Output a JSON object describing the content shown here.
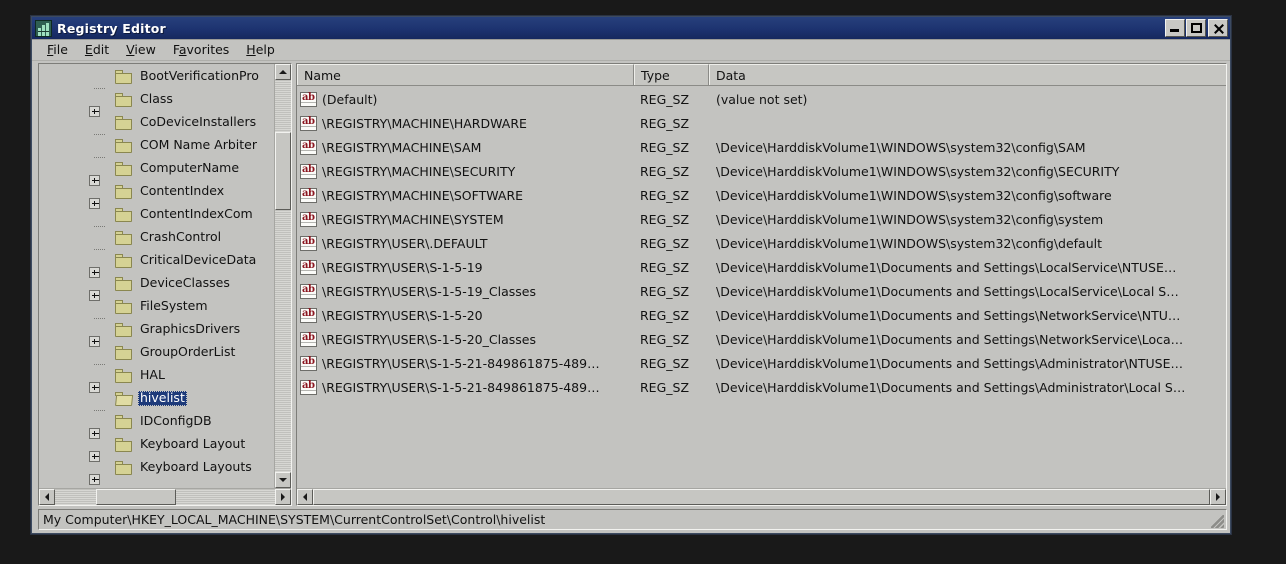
{
  "window": {
    "title": "Registry Editor",
    "icon": "registry-editor-icon",
    "controls": {
      "minimize": "minimize-button",
      "maximize": "maximize-button",
      "close": "close-button"
    }
  },
  "menubar": {
    "items": [
      {
        "label": "File",
        "accel": "F"
      },
      {
        "label": "Edit",
        "accel": "E"
      },
      {
        "label": "View",
        "accel": "V"
      },
      {
        "label": "Favorites",
        "accel": "F"
      },
      {
        "label": "Help",
        "accel": "H"
      }
    ]
  },
  "tree": {
    "items": [
      {
        "label": "BootVerificationPro",
        "expandable": false,
        "selected": false
      },
      {
        "label": "Class",
        "expandable": true,
        "selected": false
      },
      {
        "label": "CoDeviceInstallers",
        "expandable": false,
        "selected": false
      },
      {
        "label": "COM Name Arbiter",
        "expandable": false,
        "selected": false
      },
      {
        "label": "ComputerName",
        "expandable": true,
        "selected": false
      },
      {
        "label": "ContentIndex",
        "expandable": true,
        "selected": false
      },
      {
        "label": "ContentIndexCom",
        "expandable": false,
        "selected": false
      },
      {
        "label": "CrashControl",
        "expandable": false,
        "selected": false
      },
      {
        "label": "CriticalDeviceData",
        "expandable": true,
        "selected": false
      },
      {
        "label": "DeviceClasses",
        "expandable": true,
        "selected": false
      },
      {
        "label": "FileSystem",
        "expandable": false,
        "selected": false
      },
      {
        "label": "GraphicsDrivers",
        "expandable": true,
        "selected": false
      },
      {
        "label": "GroupOrderList",
        "expandable": false,
        "selected": false
      },
      {
        "label": "HAL",
        "expandable": true,
        "selected": false
      },
      {
        "label": "hivelist",
        "expandable": false,
        "selected": true
      },
      {
        "label": "IDConfigDB",
        "expandable": true,
        "selected": false
      },
      {
        "label": "Keyboard Layout",
        "expandable": true,
        "selected": false
      },
      {
        "label": "Keyboard Layouts",
        "expandable": true,
        "selected": false
      }
    ]
  },
  "list": {
    "columns": [
      {
        "label": "Name"
      },
      {
        "label": "Type"
      },
      {
        "label": "Data"
      }
    ],
    "rows": [
      {
        "name": "(Default)",
        "type": "REG_SZ",
        "data": "(value not set)",
        "icon": "string-value-icon"
      },
      {
        "name": "\\REGISTRY\\MACHINE\\HARDWARE",
        "type": "REG_SZ",
        "data": "",
        "icon": "string-value-icon"
      },
      {
        "name": "\\REGISTRY\\MACHINE\\SAM",
        "type": "REG_SZ",
        "data": "\\Device\\HarddiskVolume1\\WINDOWS\\system32\\config\\SAM",
        "icon": "string-value-icon"
      },
      {
        "name": "\\REGISTRY\\MACHINE\\SECURITY",
        "type": "REG_SZ",
        "data": "\\Device\\HarddiskVolume1\\WINDOWS\\system32\\config\\SECURITY",
        "icon": "string-value-icon"
      },
      {
        "name": "\\REGISTRY\\MACHINE\\SOFTWARE",
        "type": "REG_SZ",
        "data": "\\Device\\HarddiskVolume1\\WINDOWS\\system32\\config\\software",
        "icon": "string-value-icon"
      },
      {
        "name": "\\REGISTRY\\MACHINE\\SYSTEM",
        "type": "REG_SZ",
        "data": "\\Device\\HarddiskVolume1\\WINDOWS\\system32\\config\\system",
        "icon": "string-value-icon"
      },
      {
        "name": "\\REGISTRY\\USER\\.DEFAULT",
        "type": "REG_SZ",
        "data": "\\Device\\HarddiskVolume1\\WINDOWS\\system32\\config\\default",
        "icon": "string-value-icon"
      },
      {
        "name": "\\REGISTRY\\USER\\S-1-5-19",
        "type": "REG_SZ",
        "data": "\\Device\\HarddiskVolume1\\Documents and Settings\\LocalService\\NTUSE…",
        "icon": "string-value-icon"
      },
      {
        "name": "\\REGISTRY\\USER\\S-1-5-19_Classes",
        "type": "REG_SZ",
        "data": "\\Device\\HarddiskVolume1\\Documents and Settings\\LocalService\\Local S…",
        "icon": "string-value-icon"
      },
      {
        "name": "\\REGISTRY\\USER\\S-1-5-20",
        "type": "REG_SZ",
        "data": "\\Device\\HarddiskVolume1\\Documents and Settings\\NetworkService\\NTU…",
        "icon": "string-value-icon"
      },
      {
        "name": "\\REGISTRY\\USER\\S-1-5-20_Classes",
        "type": "REG_SZ",
        "data": "\\Device\\HarddiskVolume1\\Documents and Settings\\NetworkService\\Loca…",
        "icon": "string-value-icon"
      },
      {
        "name": "\\REGISTRY\\USER\\S-1-5-21-849861875-489…",
        "type": "REG_SZ",
        "data": "\\Device\\HarddiskVolume1\\Documents and Settings\\Administrator\\NTUSE…",
        "icon": "string-value-icon"
      },
      {
        "name": "\\REGISTRY\\USER\\S-1-5-21-849861875-489…",
        "type": "REG_SZ",
        "data": "\\Device\\HarddiskVolume1\\Documents and Settings\\Administrator\\Local S…",
        "icon": "string-value-icon"
      }
    ]
  },
  "statusbar": {
    "path": "My Computer\\HKEY_LOCAL_MACHINE\\SYSTEM\\CurrentControlSet\\Control\\hivelist"
  },
  "colors": {
    "titlebar": "#1d3370",
    "face": "#c3c3c0",
    "selection": "#1d3a7a",
    "folder": "#d5d294",
    "string_icon_text": "#8c1721",
    "desktop": "#191919"
  }
}
